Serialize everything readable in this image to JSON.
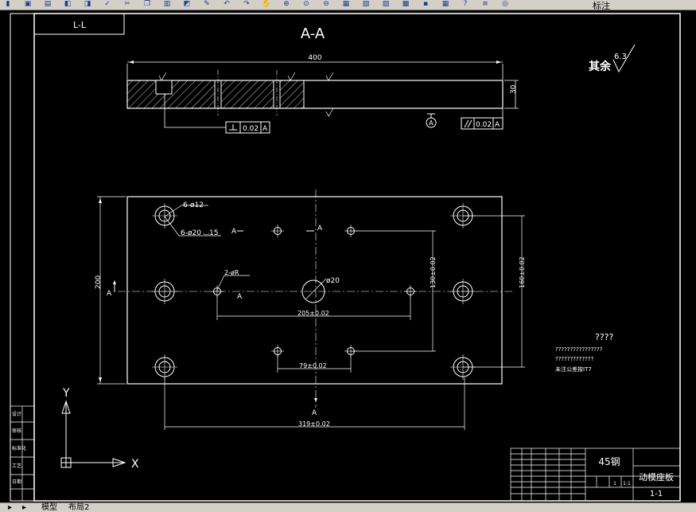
{
  "toolbar": {
    "label": "标注",
    "icons": [
      "open-icon",
      "save-icon",
      "print-icon",
      "preview-icon",
      "plot-icon",
      "spell-icon",
      "cut-icon",
      "copy-icon",
      "paste-icon",
      "match-icon",
      "brush-icon",
      "undo-icon",
      "redo-icon",
      "pan-icon",
      "zoom-realtime-icon",
      "zoom-window-icon",
      "zoom-previous-icon",
      "properties-icon",
      "design-center-icon",
      "tool-palette-icon",
      "sheet-icon",
      "markup-icon",
      "calc-icon",
      "help-icon",
      "layer-icon",
      "layer-state-icon"
    ]
  },
  "drawing": {
    "corner_tag": "L-L",
    "section_title": "A-A",
    "roughness_prefix": "其余",
    "roughness_value": "6.3",
    "dim_length": "400",
    "dim_thickness": "30",
    "tol_perp_value": "0.02",
    "tol_perp_datum": "A",
    "tol_par_value": "0.02",
    "tol_par_datum": "A",
    "datum_symbol": "A",
    "hole_label_1": "6-ø12",
    "hole_label_2": "6-ø20 ⌴15",
    "hole_label_3": "2-øR",
    "center_hole_label": "ø20",
    "dim_height": "200",
    "dim_205": "205±0.02",
    "dim_130": "130±0.02",
    "dim_160": "160±0.02",
    "dim_79": "79±0.02",
    "dim_319": "319±0.02",
    "section_mark_left": "A",
    "section_mark_top": "A",
    "section_mark_bottom": "A",
    "section_mark_a": "A",
    "notes_title": "????",
    "notes_line_1": "????????????????",
    "notes_line_2": "?????????????",
    "notes_line_3": "未注公差按IT7",
    "axis_y": "Y",
    "axis_x": "X"
  },
  "title_block": {
    "material": "45钢",
    "part_name": "动模座板",
    "drawing_no": "1-1",
    "scale_1": "1",
    "scale_2": "1:1",
    "left_labels": [
      "设计",
      "审核",
      "标准化",
      "工艺",
      "日期"
    ]
  },
  "tabs": {
    "model": "模型",
    "layout": "布局2"
  }
}
